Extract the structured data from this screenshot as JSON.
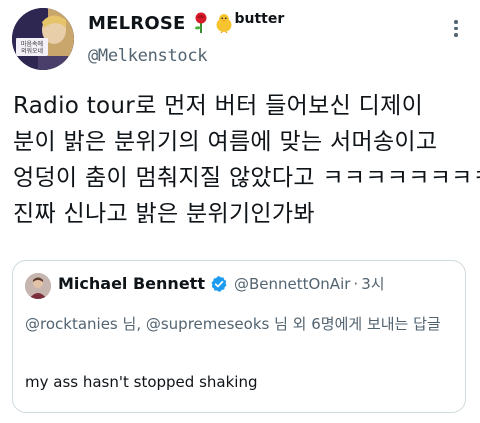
{
  "author": {
    "display_name": "MELROSE",
    "name_suffix": "butter",
    "handle": "@Melkenstock",
    "avatar_sign_line1": "마음속에",
    "avatar_sign_line2": "외워오네"
  },
  "tweet": {
    "lines": [
      "Radio tour로 먼저 버터 들어보신 디제이",
      "분이 밝은 분위기의 여름에 맞는 서머송이고",
      "엉덩이 춤이 멈춰지질 않았다고 ㅋㅋㅋㅋㅋㅋㅋㅋ",
      "진짜 신나고 밝은 분위기인가봐"
    ]
  },
  "quoted_tweet": {
    "name": "Michael Bennett",
    "handle": "@BennettOnAir",
    "separator": "·",
    "time": "3시",
    "reply_mention_1": "@rocktanies",
    "reply_text_1": " 님, ",
    "reply_mention_2": "@supremeseoks",
    "reply_text_2": " 님 외 6명에게 보내는 답글",
    "body": "my ass hasn't stopped shaking"
  },
  "colors": {
    "text": "#0f1419",
    "secondary": "#536471",
    "verified": "#1d9bf0",
    "border": "#cfd9de"
  }
}
